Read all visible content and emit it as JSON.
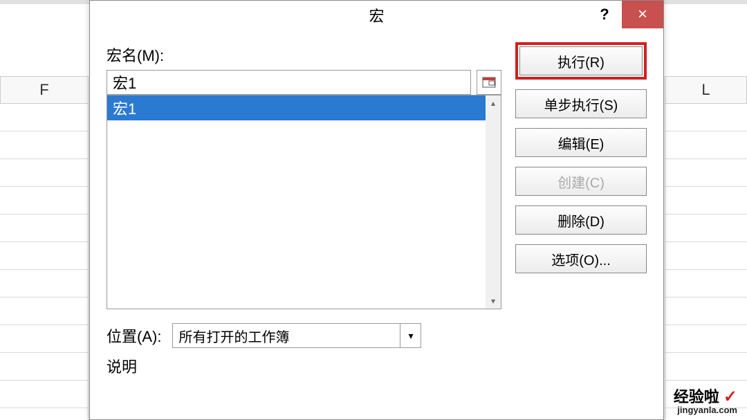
{
  "titlebar": {
    "title": "宏",
    "help": "?",
    "close": "×"
  },
  "spreadsheet": {
    "left_col": "F",
    "right_col": "L"
  },
  "labels": {
    "macro_name": "宏名(M):",
    "location": "位置(A):",
    "description": "说明"
  },
  "inputs": {
    "macro_name_value": "宏1"
  },
  "macro_list": {
    "items": [
      "宏1"
    ],
    "selected_index": 0
  },
  "location_select": {
    "value": "所有打开的工作簿"
  },
  "buttons": {
    "run": "执行(R)",
    "step": "单步执行(S)",
    "edit": "编辑(E)",
    "create": "创建(C)",
    "delete": "删除(D)",
    "options": "选项(O)..."
  },
  "scroll": {
    "up": "▴",
    "down": "▾"
  },
  "watermark": {
    "main": "经验啦",
    "check": "✓",
    "url": "jingyanla.com"
  }
}
